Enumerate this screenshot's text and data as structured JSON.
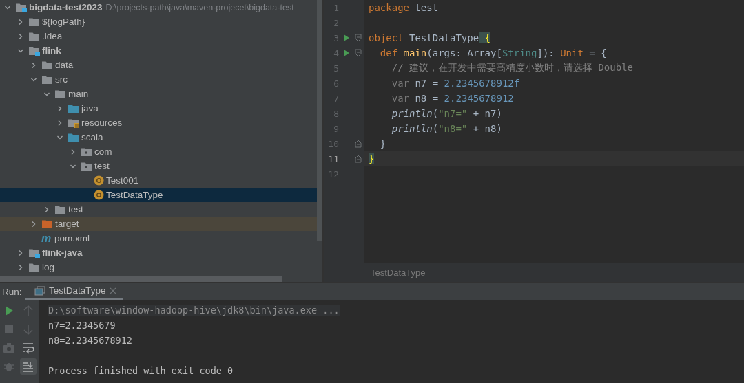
{
  "project_tree": {
    "items": [
      {
        "label": "bigdata-test2023",
        "path": "D:\\projects-path\\java\\maven-projecet\\bigdata-test",
        "kind": "module",
        "expanded": true,
        "selected": false,
        "children": [
          {
            "label": "${logPath}",
            "kind": "folder",
            "expanded": false,
            "selected": false
          },
          {
            "label": ".idea",
            "kind": "folder",
            "expanded": false,
            "selected": false
          },
          {
            "label": "flink",
            "kind": "module",
            "expanded": true,
            "selected": false,
            "children": [
              {
                "label": "data",
                "kind": "folder",
                "expanded": false,
                "selected": false
              },
              {
                "label": "src",
                "kind": "folder",
                "expanded": true,
                "selected": false,
                "children": [
                  {
                    "label": "main",
                    "kind": "folder",
                    "expanded": true,
                    "selected": false,
                    "children": [
                      {
                        "label": "java",
                        "kind": "source",
                        "expanded": false,
                        "selected": false
                      },
                      {
                        "label": "resources",
                        "kind": "resources",
                        "expanded": false,
                        "selected": false
                      },
                      {
                        "label": "scala",
                        "kind": "source",
                        "expanded": true,
                        "selected": false,
                        "children": [
                          {
                            "label": "com",
                            "kind": "package",
                            "expanded": false,
                            "selected": false
                          },
                          {
                            "label": "test",
                            "kind": "package",
                            "expanded": true,
                            "selected": false,
                            "children": [
                              {
                                "label": "Test001",
                                "kind": "object",
                                "selected": false
                              },
                              {
                                "label": "TestDataType",
                                "kind": "object",
                                "selected": true
                              }
                            ]
                          }
                        ]
                      }
                    ]
                  },
                  {
                    "label": "test",
                    "kind": "folder",
                    "expanded": false,
                    "selected": false
                  }
                ]
              },
              {
                "label": "target",
                "kind": "excluded",
                "expanded": false,
                "selected": false
              },
              {
                "label": "pom.xml",
                "kind": "maven",
                "icon_text": "m",
                "selected": false
              }
            ]
          },
          {
            "label": "flink-java",
            "kind": "module",
            "expanded": false,
            "selected": false
          },
          {
            "label": "log",
            "kind": "folder",
            "expanded": false,
            "selected": false
          }
        ]
      }
    ]
  },
  "editor": {
    "lines": [
      {
        "number": "1",
        "kind": "plain",
        "run": false,
        "current": false,
        "tokens": [
          {
            "t": "package",
            "kind": "kw"
          },
          {
            "t": " test",
            "kind": "plain"
          }
        ]
      },
      {
        "number": "2",
        "kind": "plain",
        "run": false,
        "current": false
      },
      {
        "number": "3",
        "kind": "fold-start",
        "run": true,
        "current": false,
        "tokens": [
          {
            "t": "object",
            "kind": "kw"
          },
          {
            "t": " TestDataType",
            "kind": "plain"
          },
          {
            "t": " {",
            "kind": "brace"
          }
        ]
      },
      {
        "number": "4",
        "kind": "fold-start",
        "run": true,
        "current": false,
        "tokens": [
          {
            "t": "  def",
            "kind": "kw"
          },
          {
            "t": " main",
            "kind": "fn"
          },
          {
            "t": "(args: Array[",
            "kind": "plain"
          },
          {
            "t": "String",
            "kind": "type"
          },
          {
            "t": "]): ",
            "kind": "plain"
          },
          {
            "t": "Unit",
            "kind": "kw"
          },
          {
            "t": " = {",
            "kind": "plain"
          }
        ]
      },
      {
        "number": "5",
        "kind": "plain",
        "run": false,
        "current": false,
        "tokens": [
          {
            "t": "    // 建议，在开发中需要高精度小数时，请选择 Double",
            "kind": "comment"
          }
        ]
      },
      {
        "number": "6",
        "kind": "plain",
        "run": false,
        "current": false,
        "tokens": [
          {
            "t": "    var",
            "kind": "dim"
          },
          {
            "t": " n7 = ",
            "kind": "plain"
          },
          {
            "t": "2.2345678912f",
            "kind": "num"
          }
        ]
      },
      {
        "number": "7",
        "kind": "plain",
        "run": false,
        "current": false,
        "tokens": [
          {
            "t": "    var",
            "kind": "dim"
          },
          {
            "t": " n8 = ",
            "kind": "plain"
          },
          {
            "t": "2.2345678912",
            "kind": "num"
          }
        ]
      },
      {
        "number": "8",
        "kind": "plain",
        "run": false,
        "current": false,
        "tokens": [
          {
            "t": "    println",
            "kind": "italic"
          },
          {
            "t": "(",
            "kind": "plain"
          },
          {
            "t": "\"n7=\"",
            "kind": "str"
          },
          {
            "t": " + n7)",
            "kind": "plain"
          }
        ]
      },
      {
        "number": "9",
        "kind": "plain",
        "run": false,
        "current": false,
        "tokens": [
          {
            "t": "    println",
            "kind": "italic"
          },
          {
            "t": "(",
            "kind": "plain"
          },
          {
            "t": "\"n8=\"",
            "kind": "str"
          },
          {
            "t": " + n8)",
            "kind": "plain"
          }
        ]
      },
      {
        "number": "10",
        "kind": "fold-end",
        "run": false,
        "current": false,
        "tokens": [
          {
            "t": "  }",
            "kind": "plain"
          }
        ]
      },
      {
        "number": "11",
        "kind": "fold-end",
        "run": false,
        "current": true,
        "tokens": [
          {
            "t": "}",
            "kind": "brace"
          }
        ]
      },
      {
        "number": "12",
        "kind": "plain",
        "run": false,
        "current": false
      }
    ],
    "breadcrumb": "TestDataType"
  },
  "run_panel": {
    "label": "Run:",
    "tabs": [
      {
        "label": "TestDataType",
        "selected": true
      }
    ],
    "toolbar": [
      {
        "kind": "rerun",
        "disabled": false,
        "on": false
      },
      {
        "kind": "up",
        "disabled": true,
        "on": false
      },
      {
        "kind": "stop",
        "disabled": true,
        "on": false
      },
      {
        "kind": "down",
        "disabled": true,
        "on": false
      },
      {
        "kind": "camera",
        "disabled": true,
        "on": false
      },
      {
        "kind": "wrap",
        "disabled": false,
        "on": false
      },
      {
        "kind": "debug",
        "disabled": true,
        "on": false
      },
      {
        "kind": "scroll-end",
        "disabled": false,
        "on": true
      }
    ],
    "console": [
      {
        "kind": "command",
        "text": "D:\\software\\window-hadoop-hive\\jdk8\\bin\\java.exe ..."
      },
      {
        "kind": "output",
        "text": "n7=2.2345679"
      },
      {
        "kind": "output",
        "text": "n8=2.2345678912"
      },
      {
        "kind": "blank"
      },
      {
        "kind": "output",
        "text": "Process finished with exit code 0"
      }
    ]
  }
}
